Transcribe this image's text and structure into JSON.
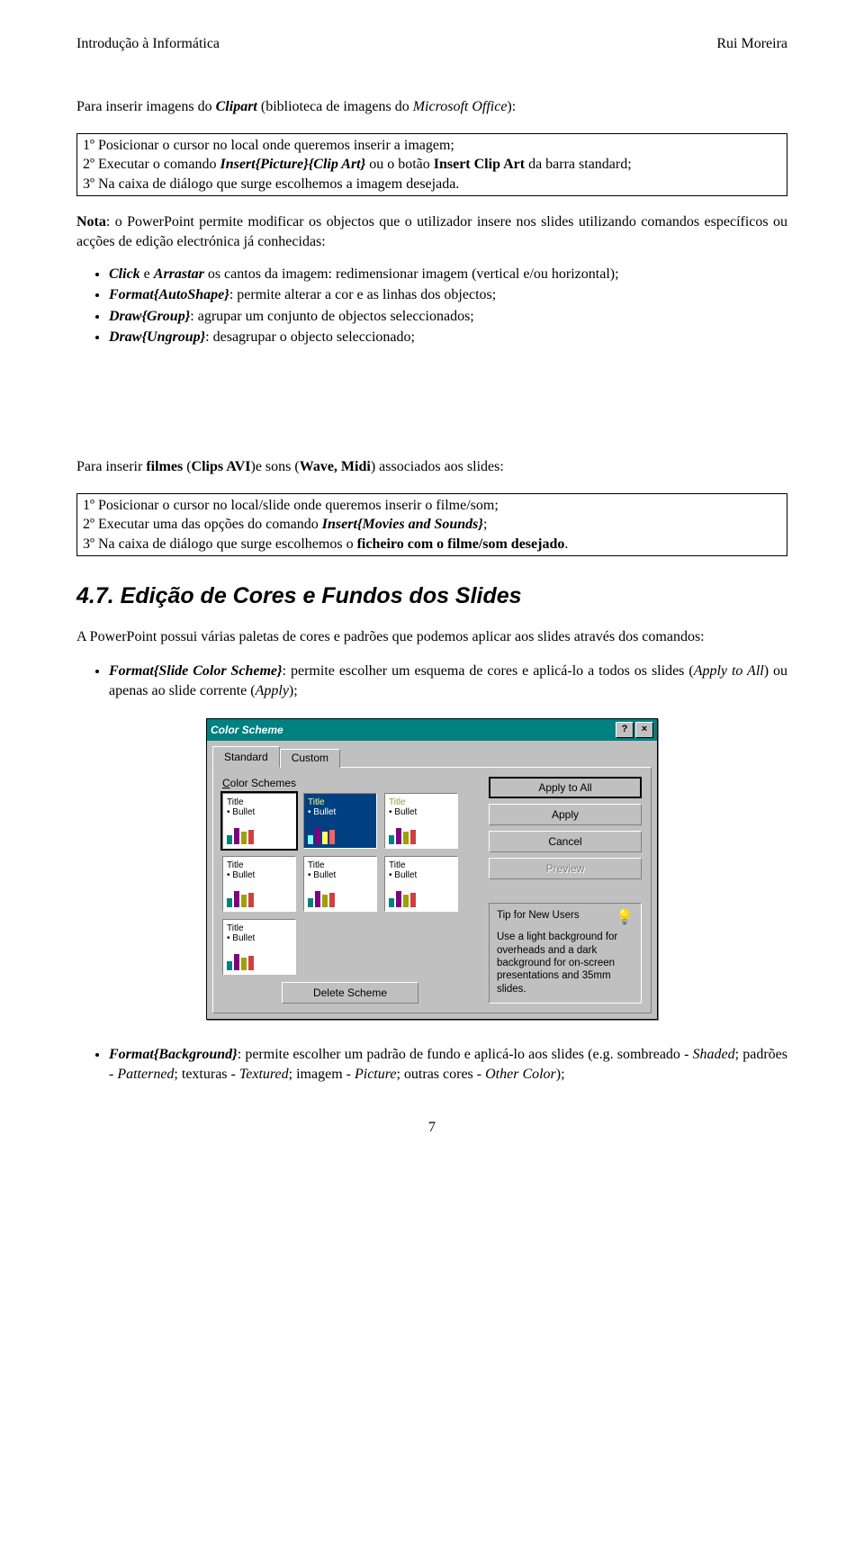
{
  "header": {
    "left": "Introdução à Informática",
    "right": "Rui Moreira"
  },
  "intro1_pre": "Para inserir imagens do ",
  "intro1_i1": "Clipart",
  "intro1_mid": " (biblioteca de imagens do ",
  "intro1_i2": "Microsoft Office",
  "intro1_post": "):",
  "box1": {
    "l1a": "1º Posicionar o cursor no local onde queremos inserir a imagem;",
    "l2a": "2º Executar o comando ",
    "l2b": "Insert{Picture}{Clip Art}",
    "l2c": " ou o botão ",
    "l2d": "Insert Clip Art",
    "l2e": " da barra standard;",
    "l3a": "3º Na caixa de diálogo que surge escolhemos a imagem desejada."
  },
  "nota_b": "Nota",
  "nota_txt": ": o PowerPoint permite modificar os objectos que o utilizador insere nos slides utilizando comandos específicos ou acções de edição electrónica já conhecidas:",
  "bul1": {
    "a_i": "Click",
    "a_mid": " e ",
    "a_i2": "Arrastar",
    "a_rest": " os cantos da imagem: redimensionar imagem (vertical e/ou horizontal);",
    "b_i": "Format{AutoShape}",
    "b_rest": ": permite alterar a cor e as linhas dos objectos;",
    "c_i": "Draw{Group}",
    "c_rest": ": agrupar um conjunto de objectos seleccionados;",
    "d_i": "Draw{Ungroup}",
    "d_rest": ": desagrupar o objecto seleccionado;"
  },
  "intro2_pre": "Para inserir ",
  "intro2_b1": "filmes",
  "intro2_mid1": " (",
  "intro2_b2": "Clips AVI",
  "intro2_mid2": ")e sons (",
  "intro2_b3": "Wave, Midi",
  "intro2_post": ") associados aos slides:",
  "box2": {
    "l1": "1º Posicionar o cursor no local/slide onde queremos inserir o filme/som;",
    "l2a": "2º Executar uma das opções do comando ",
    "l2b": "Insert{Movies and Sounds}",
    "l2c": ";",
    "l3a": "3º Na caixa de diálogo que surge escolhemos o ",
    "l3b": "ficheiro com o filme/som desejado",
    "l3c": "."
  },
  "h2": "4.7. Edição de Cores e Fundos dos Slides",
  "p3": "A PowerPoint possui várias paletas de cores e padrões que podemos aplicar aos slides através dos comandos:",
  "bul2a_i": "Format{Slide Color Scheme}",
  "bul2a_rest_a": ": permite escolher um esquema de cores e aplicá-lo a todos os slides (",
  "bul2a_rest_i1": "Apply to All",
  "bul2a_rest_b": ") ou apenas ao slide corrente (",
  "bul2a_rest_i2": "Apply",
  "bul2a_rest_c": ");",
  "dialog": {
    "title": "Color Scheme",
    "help": "?",
    "close": "×",
    "tab_std": "Standard",
    "tab_cust": "Custom",
    "group_label_pre": "C",
    "group_label_rest": "olor Schemes",
    "scheme_title": "Title",
    "scheme_bullet": "• Bullet",
    "delete": "Delete Scheme",
    "btn_applyall": "Apply to All",
    "btn_apply": "Apply",
    "btn_cancel": "Cancel",
    "btn_preview": "Preview",
    "tip_head": "Tip for New Users",
    "tip_body": "Use a light background for overheads and a dark background for on-screen presentations and 35mm slides."
  },
  "bul2b_i": "Format{Background}",
  "bul2b_rest_a": ": permite escolher um padrão de fundo e aplicá-lo aos slides (e.g. sombreado - ",
  "bul2b_rest_i1": "Shaded",
  "bul2b_rest_b": "; padrões - ",
  "bul2b_rest_i2": "Patterned",
  "bul2b_rest_c": "; texturas - ",
  "bul2b_rest_i3": "Textured",
  "bul2b_rest_d": "; imagem - ",
  "bul2b_rest_i4": "Picture",
  "bul2b_rest_e": "; outras cores - ",
  "bul2b_rest_i5": "Other Color",
  "bul2b_rest_f": ");",
  "page_number": "7"
}
